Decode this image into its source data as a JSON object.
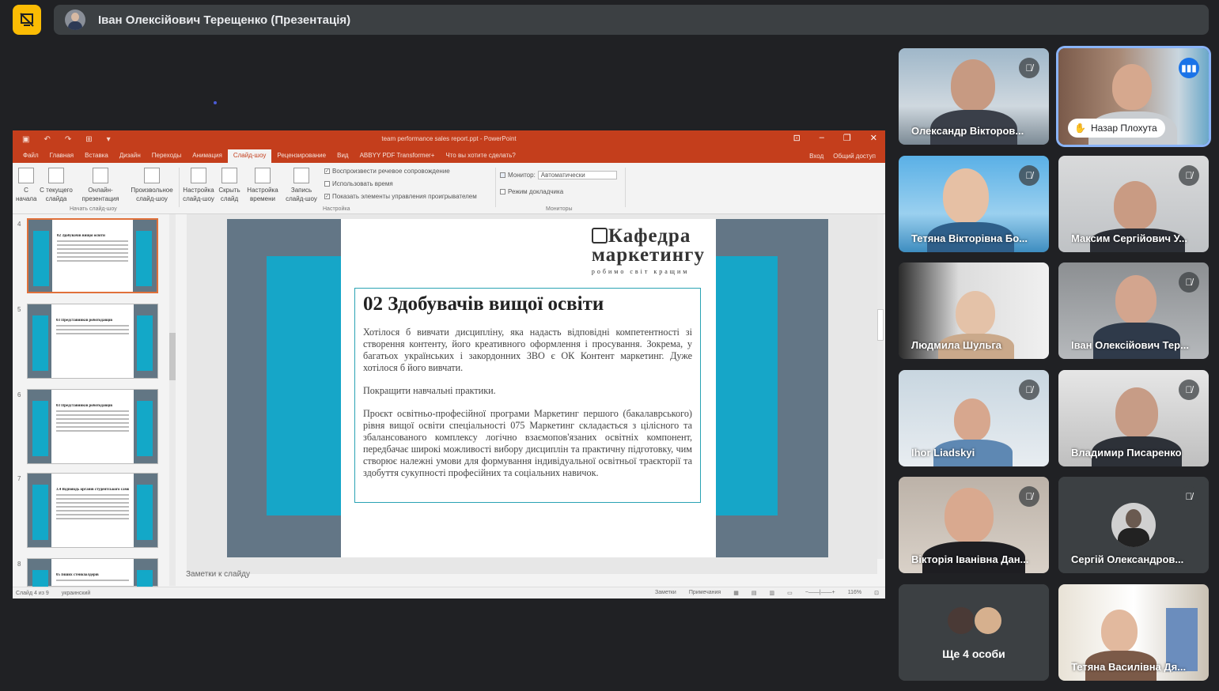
{
  "meet": {
    "presenter_title": "Іван Олексійович Терещенко (Презентація)"
  },
  "ppt": {
    "window_title": "team performance sales report.ppt - PowerPoint",
    "tabs": [
      "Файл",
      "Главная",
      "Вставка",
      "Дизайн",
      "Переходы",
      "Анимация",
      "Слайд-шоу",
      "Рецензирование",
      "Вид",
      "ABBYY PDF Transformer+",
      "Что вы хотите сделать?"
    ],
    "active_tab": "Слайд-шоу",
    "signin": "Вход",
    "share": "Общий доступ",
    "ribbon": {
      "btn_from_start": "С начала",
      "btn_from_current": "С текущего слайда",
      "btn_online": "Онлайн-презентация",
      "btn_custom": "Произвольное слайд-шоу",
      "btn_setup": "Настройка слайд-шоу",
      "btn_hide": "Скрыть слайд",
      "btn_rehearse": "Настройка времени",
      "btn_record": "Запись слайд-шоу",
      "group_start": "Начать слайд-шоу",
      "group_setup": "Настройка",
      "group_monitors": "Мониторы",
      "chk_narration": "Воспроизвести речевое сопровождение",
      "chk_timings": "Использовать время",
      "chk_controls": "Показать элементы управления проигрывателем",
      "monitor_label": "Монитор:",
      "monitor_value": "Автоматически",
      "chk_presenter": "Режим докладчика"
    },
    "thumbnails": [
      {
        "num": "4",
        "title": "02 Здобувачів вищої освіти"
      },
      {
        "num": "5",
        "title": "03 Представників роботодавців"
      },
      {
        "num": "6",
        "title": "03 Представників роботодавців"
      },
      {
        "num": "7",
        "title": "3.4 Відповідь органів студентського самоврядування"
      },
      {
        "num": "8",
        "title": "05 Інших стейкхолдерів"
      }
    ],
    "slide": {
      "logo_line1": "Кафедра",
      "logo_line2": "маркетингу",
      "logo_line3": "робимо світ кращим",
      "heading": "02 Здобувачів вищої освіти",
      "p1": "Хотілося б вивчати дисципліну, яка надасть відповідні компетентності зі створення контенту, його креативного оформлення і просування. Зокрема, у багатьох українських і закордонних ЗВО є ОК Контент маркетинг. Дуже хотілося б його вивчати.",
      "p2": "Покращити навчальні практики.",
      "p3": "Проєкт освітньо-професійної програми Маркетинг першого (бакалаврського) рівня вищої освіти спеціальності 075 Маркетинг складається з цілісного та збалансованого комплексу логічно взаємопов'язаних освітніх компонент, передбачає широкі можливості вибору дисциплін та практичну підготовку, чим створює належні умови для формування індивідуальної освітньої траєкторії та здобуття сукупності професійних та соціальних навичок."
    },
    "notes_placeholder": "Заметки к слайду",
    "status_left": "Слайд 4 из 9",
    "status_lang": "украинский",
    "status_notes": "Заметки",
    "status_comments": "Примечания",
    "status_zoom": "116%"
  },
  "participants": [
    {
      "name": "Олександр Вікторов...",
      "muted": true
    },
    {
      "name": "Назар Плохута",
      "speaking": true
    },
    {
      "name": "Тетяна Вікторівна Бо...",
      "muted": true
    },
    {
      "name": "Максим Сергійович У...",
      "muted": true
    },
    {
      "name": "Людмила Шульга",
      "muted": false
    },
    {
      "name": "Іван Олексійович Тер...",
      "muted": true
    },
    {
      "name": "Ihor Liadskyi",
      "muted": true
    },
    {
      "name": "Владимир Писаренко",
      "muted": true
    },
    {
      "name": "Вікторія Іванівна Дан...",
      "muted": true
    },
    {
      "name": "Сергій Олександров...",
      "muted": true
    },
    {
      "name": "Ще 4 особи"
    },
    {
      "name": "Тетяна Василівна Дя..."
    }
  ]
}
